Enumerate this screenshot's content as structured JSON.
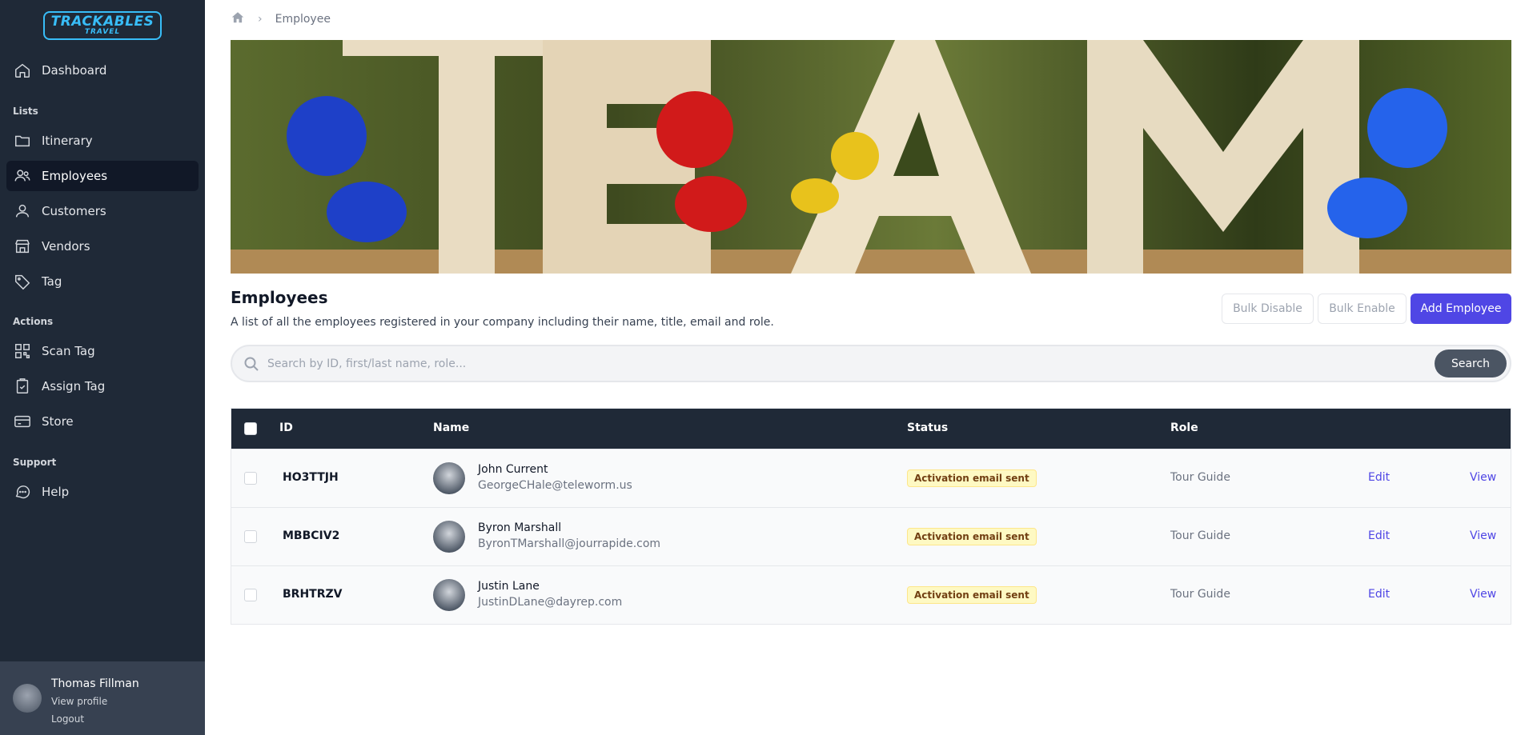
{
  "brand": {
    "logo_line1": "TRACKABLES",
    "logo_line2": "TRAVEL"
  },
  "sidebar": {
    "dashboard": {
      "label": "Dashboard",
      "icon": "home-icon"
    },
    "lists_label": "Lists",
    "lists": [
      {
        "label": "Itinerary",
        "icon": "folder-icon"
      },
      {
        "label": "Employees",
        "icon": "users-icon",
        "active": true
      },
      {
        "label": "Customers",
        "icon": "user-icon"
      },
      {
        "label": "Vendors",
        "icon": "store-icon"
      },
      {
        "label": "Tag",
        "icon": "tag-icon"
      }
    ],
    "actions_label": "Actions",
    "actions": [
      {
        "label": "Scan Tag",
        "icon": "qr-code-icon"
      },
      {
        "label": "Assign Tag",
        "icon": "clipboard-icon"
      },
      {
        "label": "Store",
        "icon": "credit-card-icon"
      }
    ],
    "support_label": "Support",
    "support": [
      {
        "label": "Help",
        "icon": "chat-bubble-icon"
      }
    ],
    "profile": {
      "name": "Thomas Fillman",
      "view_profile": "View profile",
      "logout": "Logout"
    }
  },
  "breadcrumb": {
    "current": "Employee"
  },
  "page": {
    "title": "Employees",
    "subtitle": "A list of all the employees registered in your company including their name, title, email and role.",
    "bulk_disable": "Bulk Disable",
    "bulk_enable": "Bulk Enable",
    "add_employee": "Add Employee"
  },
  "search": {
    "placeholder": "Search by ID, first/last name, role...",
    "value": "",
    "button": "Search"
  },
  "table": {
    "headers": {
      "id": "ID",
      "name": "Name",
      "status": "Status",
      "role": "Role"
    },
    "rows": [
      {
        "id": "HO3TTJH",
        "name": "John Current",
        "email": "GeorgeCHale@teleworm.us",
        "status": "Activation email sent",
        "role": "Tour Guide",
        "edit": "Edit",
        "view": "View"
      },
      {
        "id": "MBBCIV2",
        "name": "Byron Marshall",
        "email": "ByronTMarshall@jourrapide.com",
        "status": "Activation email sent",
        "role": "Tour Guide",
        "edit": "Edit",
        "view": "View"
      },
      {
        "id": "BRHTRZV",
        "name": "Justin Lane",
        "email": "JustinDLane@dayrep.com",
        "status": "Activation email sent",
        "role": "Tour Guide",
        "edit": "Edit",
        "view": "View"
      }
    ]
  },
  "colors": {
    "sidebar_bg": "#1f2937",
    "accent": "#4f46e5",
    "badge_bg": "#fef9c3",
    "logo": "#38bdf8"
  }
}
